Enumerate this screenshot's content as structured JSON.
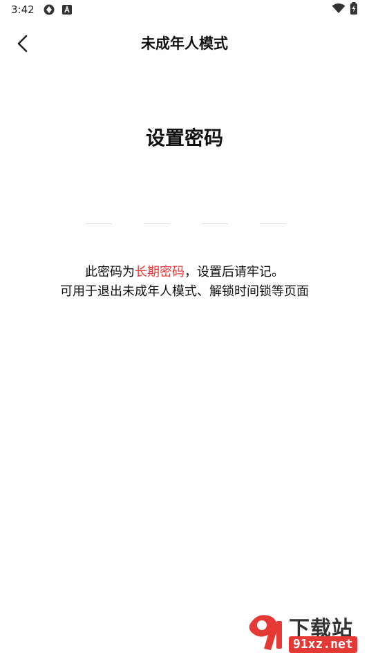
{
  "status_bar": {
    "time": "3:42",
    "icons": [
      "sync-icon",
      "a-badge-icon",
      "wifi-icon",
      "battery-charging-icon"
    ]
  },
  "header": {
    "title": "未成年人模式"
  },
  "main": {
    "section_title": "设置密码",
    "pin_slots": 4,
    "notice_prefix": "此密码为",
    "notice_highlight": "长期密码",
    "notice_suffix": "，设置后请牢记。",
    "notice_line2": "可用于退出未成年人模式、解锁时间锁等页面"
  },
  "watermark": {
    "logo_text": "91",
    "text_top": "下载站",
    "text_bottom": "91xz.net"
  },
  "colors": {
    "highlight": "#e53935",
    "text": "#111111"
  }
}
